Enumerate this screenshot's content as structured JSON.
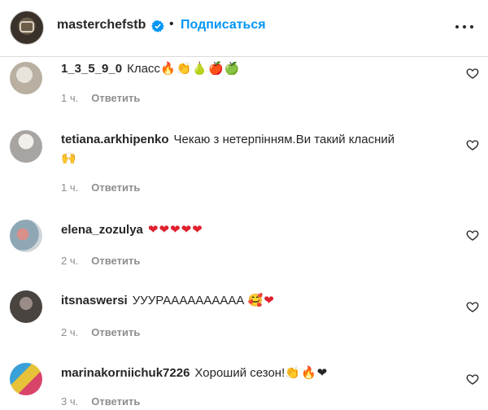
{
  "header": {
    "username": "masterchefstb",
    "separator": "•",
    "follow_label": "Подписаться"
  },
  "comments": [
    {
      "user": "1_3_5_9_0",
      "text": "Класс",
      "emoji": "🔥👏🍐🍎🍏",
      "time": "1 ч.",
      "reply": "Ответить"
    },
    {
      "user": "tetiana.arkhipenko",
      "text": "Чекаю з нетерпінням.Ви такий класний",
      "emoji": "🙌",
      "time": "1 ч.",
      "reply": "Ответить"
    },
    {
      "user": "elena_zozulya",
      "text": "",
      "emoji": "❤❤❤❤❤",
      "time": "2 ч.",
      "reply": "Ответить"
    },
    {
      "user": "itsnaswersi",
      "text": "УУУРАААААААААА",
      "emoji": "🥰❤",
      "time": "2 ч.",
      "reply": "Ответить"
    },
    {
      "user": "marinakorniichuk7226",
      "text": "Хороший сезон!",
      "emoji": "👏🔥❤",
      "time": "3 ч.",
      "reply": "Ответить"
    }
  ],
  "colors": {
    "accent": "#0095f6",
    "heart_red": "#e0202e",
    "muted": "#8e8e8e"
  },
  "icons": {
    "verified": "verified-badge-icon",
    "more": "more-horizontal-icon",
    "like": "heart-outline-icon"
  }
}
